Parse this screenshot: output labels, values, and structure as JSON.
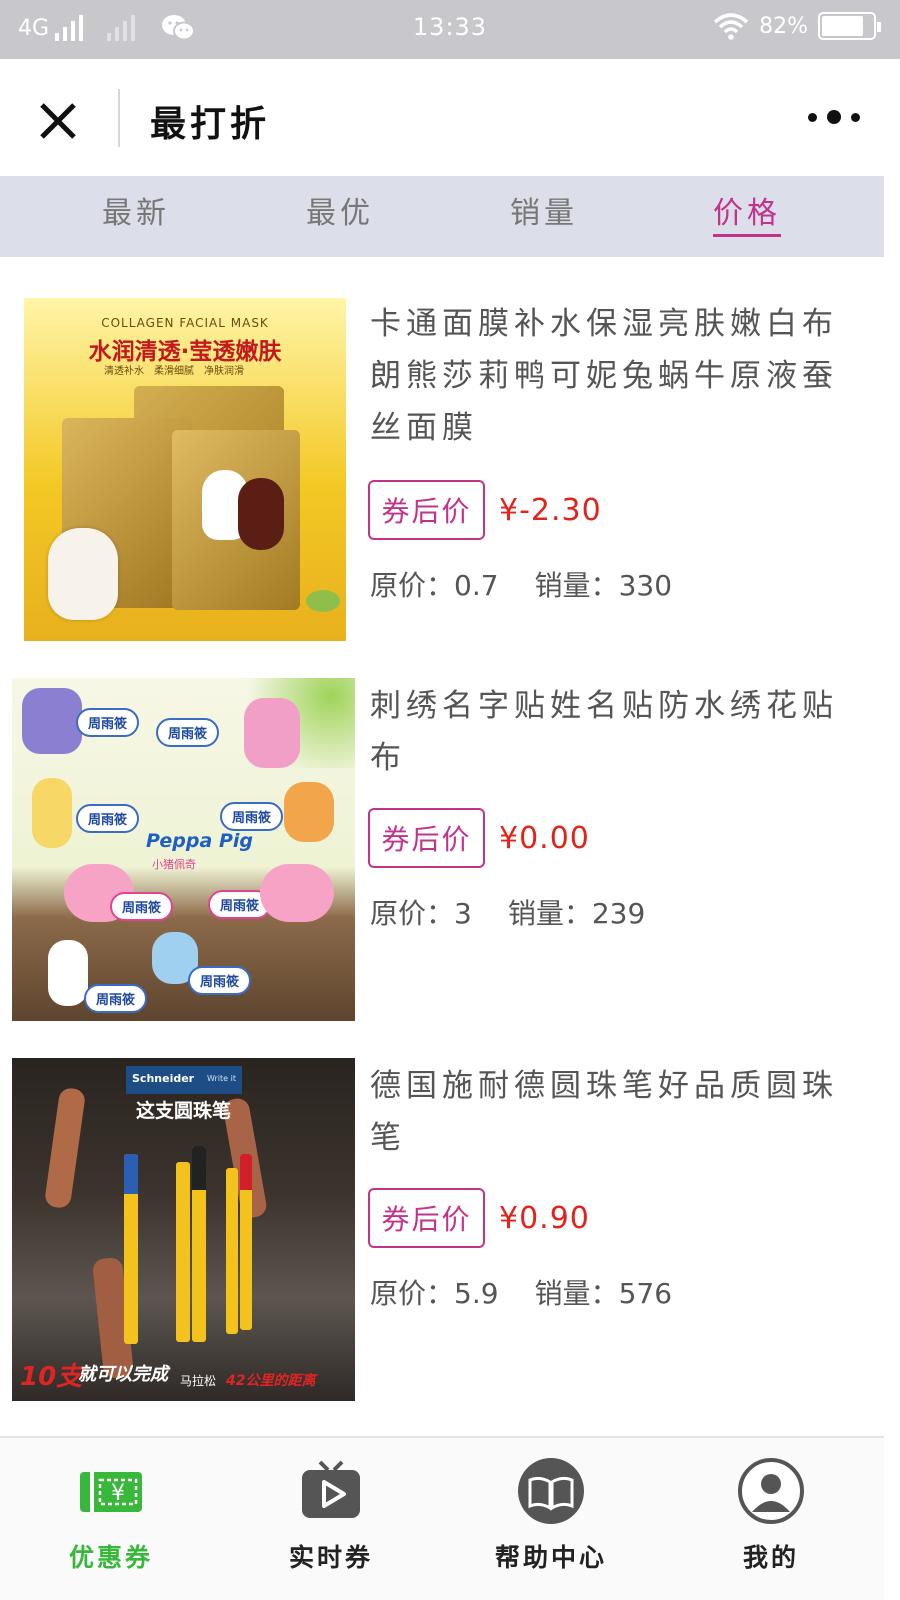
{
  "status_bar": {
    "network": "4G",
    "time": "13:33",
    "battery": "82%",
    "battery_level": 0.82
  },
  "nav": {
    "title": "最打折"
  },
  "sort_tabs": [
    {
      "label": "最新",
      "active": false
    },
    {
      "label": "最优",
      "active": false
    },
    {
      "label": "销量",
      "active": false
    },
    {
      "label": "价格",
      "active": true
    }
  ],
  "products": [
    {
      "title": "卡通面膜补水保湿亮肤嫩白布朗熊莎莉鸭可妮兔蜗牛原液蚕丝面膜",
      "coupon_label": "券后价",
      "price": "¥-2.30",
      "original_label": "原价：",
      "original": "0.7",
      "sales_label": "销量：",
      "sales": "330",
      "image": {
        "tagline_en": "COLLAGEN FACIAL MASK",
        "headline": "水润清透·莹透嫩肤",
        "features": [
          "清透补水",
          "柔滑细腻",
          "净肤润滑"
        ]
      }
    },
    {
      "title": "刺绣名字贴姓名贴防水绣花贴布",
      "coupon_label": "券后价",
      "price": "¥0.00",
      "original_label": "原价：",
      "original": "3",
      "sales_label": "销量：",
      "sales": "239",
      "image": {
        "name_tag": "周雨筱",
        "brand": "Peppa Pig",
        "brand_cn": "小猪佩奇"
      }
    },
    {
      "title": "德国施耐德圆珠笔好品质圆珠笔",
      "coupon_label": "券后价",
      "price": "¥0.90",
      "original_label": "原价：",
      "original": "5.9",
      "sales_label": "销量：",
      "sales": "576",
      "image": {
        "brand": "Schneider",
        "brand_sub": "Write it",
        "headline": "这支圆珠笔",
        "slogan_big": "10支",
        "slogan_mid": "就可以完成",
        "slogan_small": "马拉松",
        "slogan_red": "42公里的距离"
      }
    }
  ],
  "bottom_tabs": [
    {
      "label": "优惠券",
      "icon": "coupon-ticket-icon",
      "active": true
    },
    {
      "label": "实时券",
      "icon": "tv-play-icon",
      "active": false
    },
    {
      "label": "帮助中心",
      "icon": "book-icon",
      "active": false
    },
    {
      "label": "我的",
      "icon": "user-icon",
      "active": false
    }
  ],
  "colors": {
    "accent": "#c2338a",
    "price": "#e2231a",
    "active_tab_green": "#38b73a",
    "tab_bg": "#dcdfe9"
  }
}
